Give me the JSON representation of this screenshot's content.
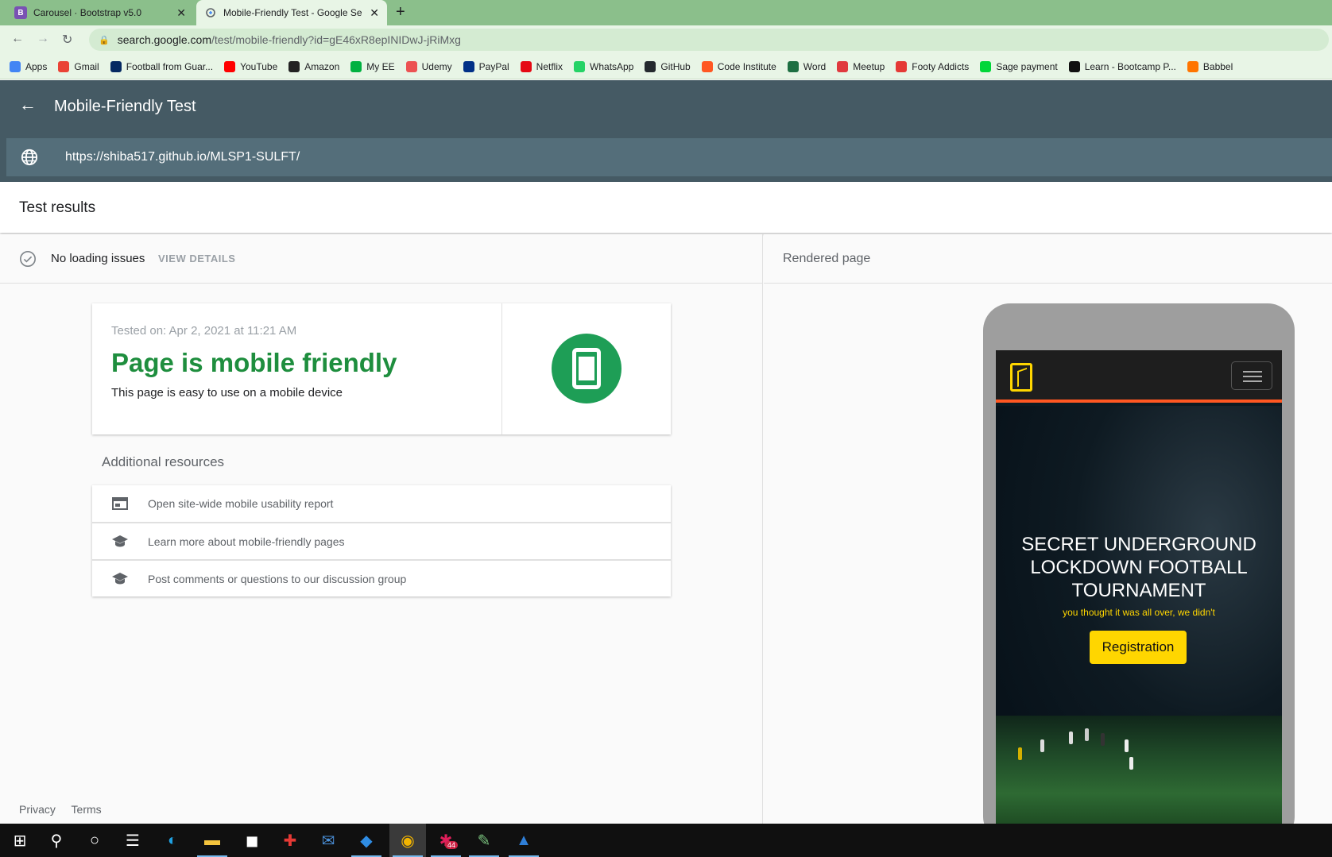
{
  "browser": {
    "tabs": [
      {
        "title": "Carousel · Bootstrap v5.0",
        "favicon_letter": "B",
        "favicon_color": "#7952b3",
        "active": false
      },
      {
        "title": "Mobile-Friendly Test - Google Se",
        "favicon_letter": "",
        "favicon_color": "#5f6368",
        "active": true
      }
    ],
    "address": {
      "domain": "search.google.com",
      "path": "/test/mobile-friendly?id=gE46xR8epINIDwJ-jRiMxg"
    },
    "bookmarks": [
      {
        "label": "Apps",
        "icon": "apps-grid-icon",
        "color": "#4285f4"
      },
      {
        "label": "Gmail",
        "icon": "gmail-icon",
        "color": "#ea4335"
      },
      {
        "label": "Football from Guar...",
        "icon": "guardian-icon",
        "color": "#052962"
      },
      {
        "label": "YouTube",
        "icon": "youtube-icon",
        "color": "#ff0000"
      },
      {
        "label": "Amazon",
        "icon": "amazon-icon",
        "color": "#222222"
      },
      {
        "label": "My EE",
        "icon": "ee-icon",
        "color": "#00b140"
      },
      {
        "label": "Udemy",
        "icon": "udemy-icon",
        "color": "#ec5252"
      },
      {
        "label": "PayPal",
        "icon": "paypal-icon",
        "color": "#003087"
      },
      {
        "label": "Netflix",
        "icon": "netflix-icon",
        "color": "#e50914"
      },
      {
        "label": "WhatsApp",
        "icon": "whatsapp-icon",
        "color": "#25d366"
      },
      {
        "label": "GitHub",
        "icon": "github-icon",
        "color": "#24292e"
      },
      {
        "label": "Code Institute",
        "icon": "code-institute-icon",
        "color": "#ff5722"
      },
      {
        "label": "Word",
        "icon": "excel-icon",
        "color": "#1d6f42"
      },
      {
        "label": "Meetup",
        "icon": "meetup-icon",
        "color": "#e0393e"
      },
      {
        "label": "Footy Addicts",
        "icon": "footy-addicts-icon",
        "color": "#e53935"
      },
      {
        "label": "Sage payment",
        "icon": "sage-icon",
        "color": "#00d639"
      },
      {
        "label": "Learn - Bootcamp P...",
        "icon": "bootcamp-icon",
        "color": "#111111"
      },
      {
        "label": "Babbel",
        "icon": "babbel-icon",
        "color": "#ff7500"
      }
    ]
  },
  "app": {
    "title": "Mobile-Friendly Test",
    "tested_url": "https://shiba517.github.io/MLSP1-SULFT/",
    "results_title": "Test results",
    "status": {
      "text": "No loading issues",
      "action": "VIEW DETAILS"
    },
    "result_card": {
      "tested_on": "Tested on: Apr 2, 2021 at 11:21 AM",
      "headline": "Page is mobile friendly",
      "subtext": "This page is easy to use on a mobile device",
      "accent": "#1e8e3e"
    },
    "resources": {
      "title": "Additional resources",
      "items": [
        {
          "label": "Open site-wide mobile usability report",
          "icon": "report-icon"
        },
        {
          "label": "Learn more about mobile-friendly pages",
          "icon": "school-icon"
        },
        {
          "label": "Post comments or questions to our discussion group",
          "icon": "school-icon"
        }
      ]
    },
    "footer": {
      "privacy": "Privacy",
      "terms": "Terms"
    },
    "rendered": {
      "title": "Rendered page",
      "hero_title": "SECRET UNDERGROUND LOCKDOWN FOOTBALL TOURNAMENT",
      "hero_subtitle": "you thought it was all over, we didn't",
      "button": "Registration"
    }
  },
  "taskbar": {
    "icons": [
      "windows-start-icon",
      "search-icon",
      "cortana-icon",
      "task-view-icon",
      "edge-icon",
      "file-explorer-icon",
      "store-icon",
      "gift-icon",
      "mail-icon",
      "vscode-icon",
      "chrome-icon",
      "slack-icon",
      "paint-icon",
      "photos-icon"
    ],
    "badge": "44"
  }
}
